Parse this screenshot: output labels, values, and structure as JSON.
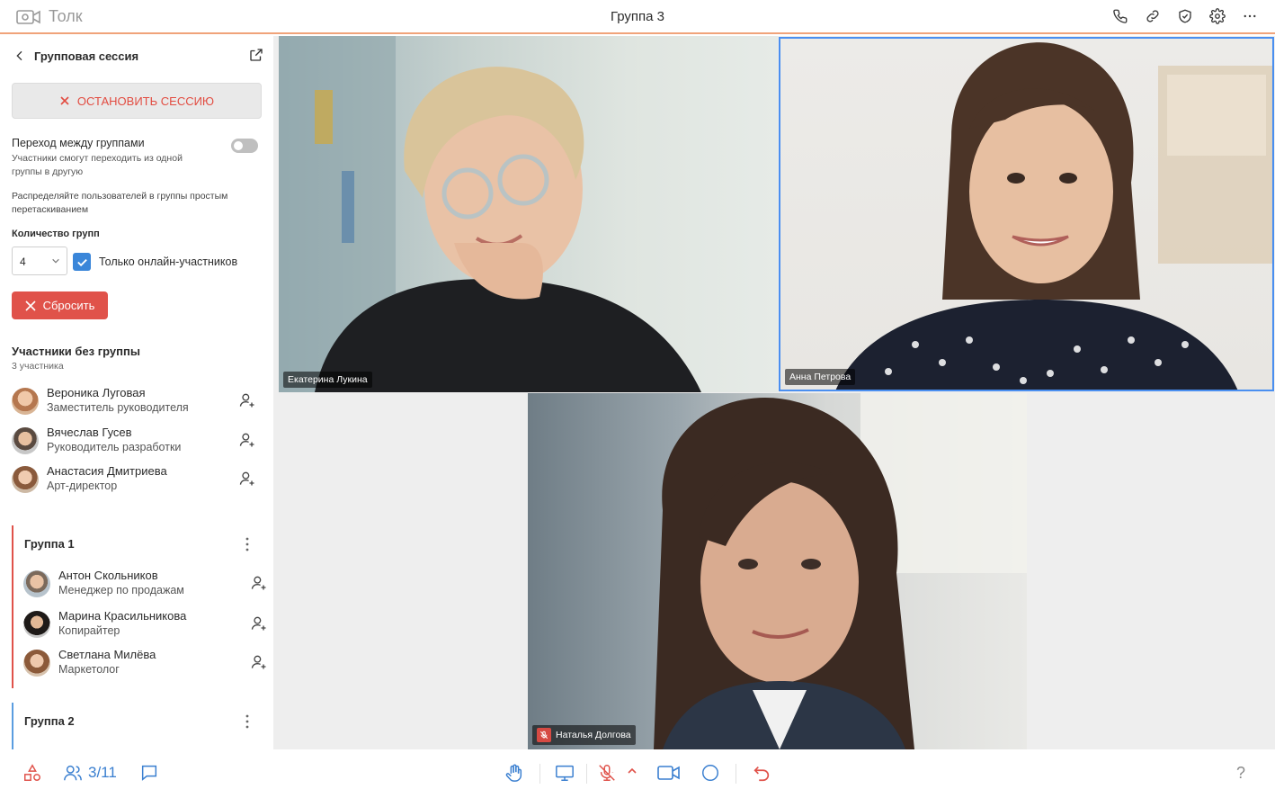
{
  "app": {
    "brand": "Толк",
    "title": "Группа 3"
  },
  "top_actions": [
    "phone-icon",
    "link-icon",
    "shield-check-icon",
    "gear-icon",
    "more-horizontal-icon"
  ],
  "sidebar": {
    "title": "Групповая сессия",
    "stop_label": "ОСТАНОВИТЬ СЕССИЮ",
    "switch_label": "Переход между группами",
    "switch_sub": "Участники смогут переходить из одной группы в другую",
    "switch_on": false,
    "hint": "Распределяйте пользователей в группы простым перетаскиванием",
    "count_label": "Количество групп",
    "count_value": "4",
    "online_only_label": "Только онлайн-участников",
    "online_only_checked": true,
    "reset_label": "Сбросить",
    "ungrouped_title": "Участники без группы",
    "ungrouped_sub": "3 участника",
    "ungrouped": [
      {
        "name": "Вероника Луговая",
        "role": "Заместитель руководителя"
      },
      {
        "name": "Вячеслав Гусев",
        "role": "Руководитель разработки"
      },
      {
        "name": "Анастасия Дмитриева",
        "role": "Арт-директор"
      }
    ],
    "groups": [
      {
        "title": "Группа 1",
        "members": [
          {
            "name": "Антон Скольников",
            "role": "Менеджер по продажам"
          },
          {
            "name": "Марина Красильникова",
            "role": "Копирайтер"
          },
          {
            "name": "Светлана Милёва",
            "role": "Маркетолог"
          }
        ]
      },
      {
        "title": "Группа 2",
        "members": []
      }
    ]
  },
  "videos": [
    {
      "name": "Екатерина Лукина",
      "muted": false,
      "active": false
    },
    {
      "name": "Анна Петрова",
      "muted": false,
      "active": true
    },
    {
      "name": "Наталья Долгова",
      "muted": true,
      "active": false
    }
  ],
  "bottom": {
    "participants_count": "3/11",
    "help": "?",
    "colors": {
      "accent_blue": "#3a7fd0",
      "accent_red": "#e0524a"
    }
  }
}
